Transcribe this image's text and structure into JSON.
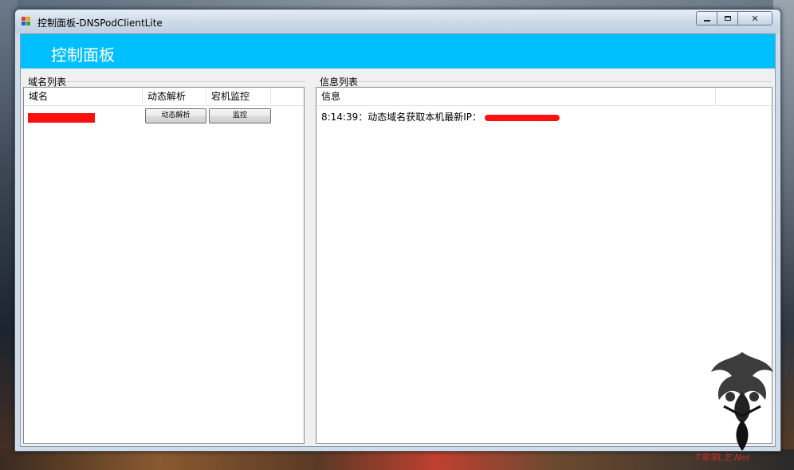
{
  "window": {
    "title": "控制面板-DNSPodClientLite",
    "controls": {
      "minimize": "minimize",
      "maximize": "maximize",
      "close": "✕"
    }
  },
  "banner": {
    "title": "控制面板"
  },
  "domain_list": {
    "group_label": "域名列表",
    "columns": [
      "域名",
      "动态解析",
      "宕机监控"
    ],
    "rows": [
      {
        "domain": "",
        "dynamic_button": "动态解析",
        "monitor_button": "监控"
      }
    ]
  },
  "info_list": {
    "group_label": "信息列表",
    "columns": [
      "信息"
    ],
    "messages": [
      {
        "text": "8:14:39：动态域名获取本机最新IP："
      }
    ]
  },
  "watermark": {
    "text": "T零零L乞.Net"
  },
  "colors": {
    "banner": "#00bfff",
    "redaction": "#ff1010"
  }
}
